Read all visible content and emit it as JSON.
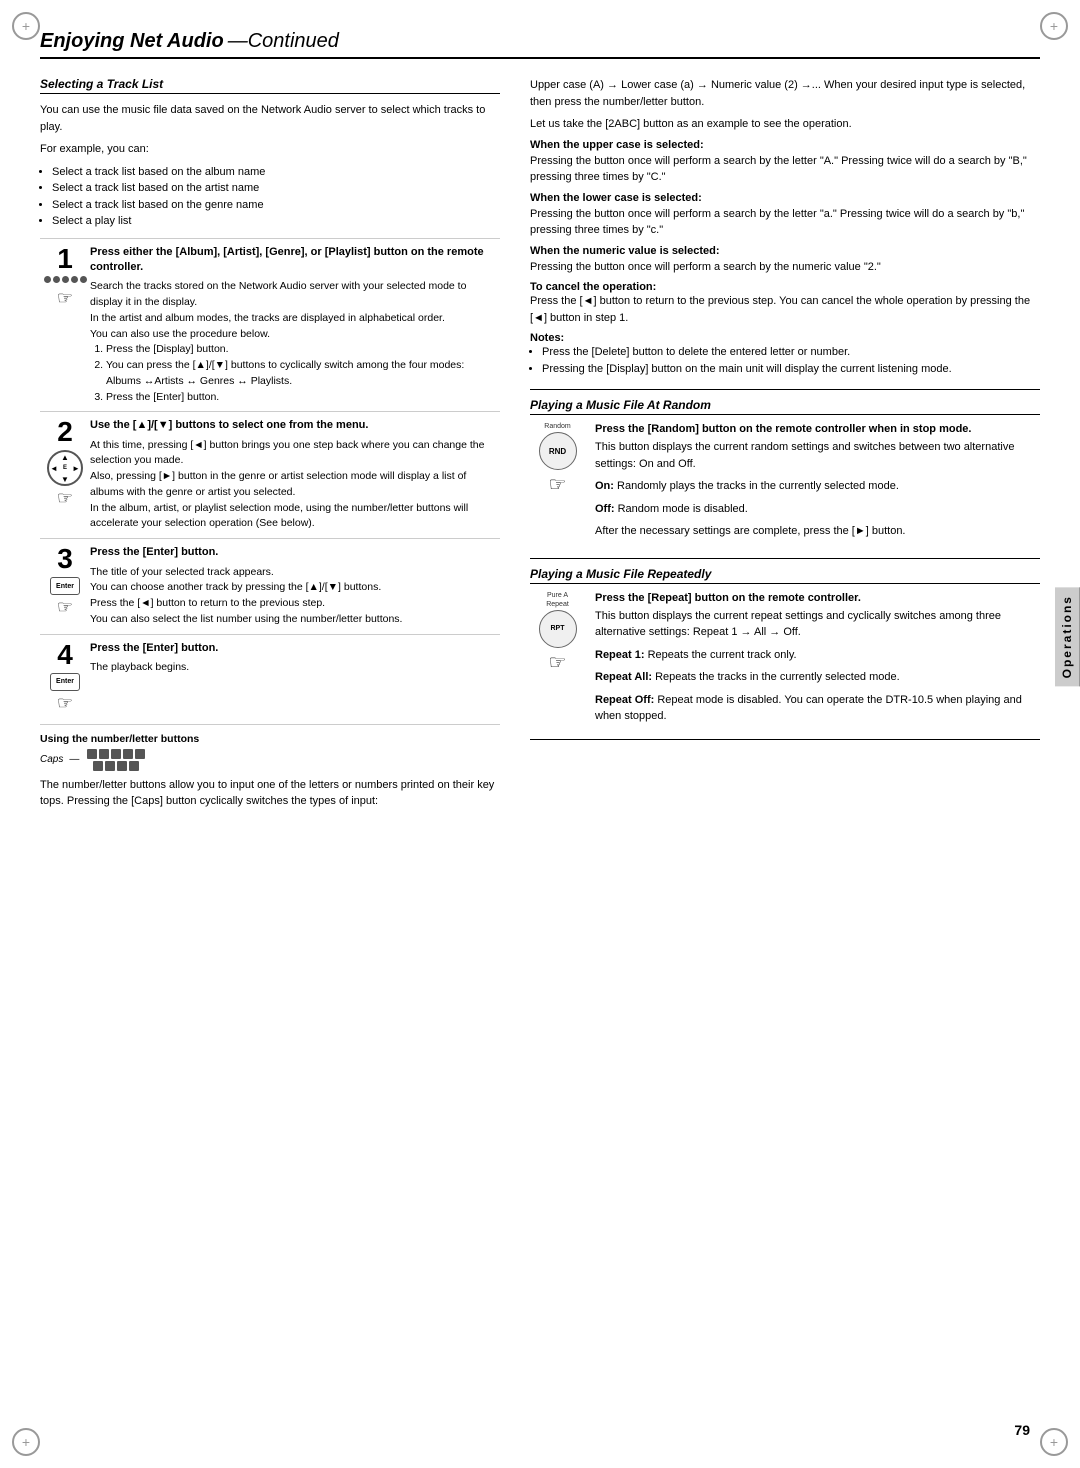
{
  "page": {
    "number": "79",
    "title_main": "Enjoying Net Audio",
    "title_continued": "—Continued"
  },
  "sidebar": {
    "label": "Operations"
  },
  "left_col": {
    "section_heading": "Selecting a Track List",
    "intro_text": "You can use the music file data saved on the Network Audio server to select which tracks to play.",
    "example_label": "For example, you can:",
    "bullets": [
      "Select a track list based on the album name",
      "Select a track list based on the artist name",
      "Select a track list based on the genre name",
      "Select a play list"
    ],
    "steps": [
      {
        "number": "1",
        "heading": "Press either the [Album], [Artist], [Genre], or [Playlist] button on the remote controller.",
        "body": "Search the tracks stored on the Network Audio server with your selected mode to display it in the display.\nIn the artist and album modes, the tracks are displayed in alphabetical order.\nYou can also use the procedure below.\n1. Press the [Display] button.\n2. You can press the [▲]/[▼] buttons to cyclically switch among the four modes: Albums ↔Artists ↔ Genres ↔ Playlists.\n3. Press the [Enter] button."
      },
      {
        "number": "2",
        "heading": "Use the [▲]/[▼] buttons to select one from the menu.",
        "body": "At this time, pressing [◄] button brings you one step back where you can change the selection you made.\nAlso, pressing [►] button in the genre or artist selection mode will display a list of albums with the genre or artist you selected.\nIn the album, artist, or playlist selection mode, using the number/letter buttons will accelerate your selection operation (See below)."
      },
      {
        "number": "3",
        "heading": "Press the [Enter] button.",
        "body": "The title of your selected track appears.\nYou can choose another track by pressing the [▲]/[▼] buttons.\nPress the [◄] button to return to the previous step.\nYou can also select the list number using the number/letter buttons."
      },
      {
        "number": "4",
        "heading": "Press the [Enter] button.",
        "body": "The playback begins."
      }
    ],
    "caps_section": {
      "heading": "Using the number/letter buttons",
      "caps_label": "Caps",
      "body": "The number/letter buttons allow you to input one of the letters or numbers printed on their key tops. Pressing the [Caps] button cyclically switches the types of input:"
    }
  },
  "right_col": {
    "input_type_text": "Upper case (A) → Lower case (a) → Numeric value (2) →... When your desired input type is selected, then press the number/letter button.",
    "example_text": "Let us take the [2ABC] button as an example to see the operation.",
    "when_upper": {
      "heading": "When the upper case is selected:",
      "body": "Pressing the button once will perform a search by the letter \"A.\" Pressing twice will do a search by \"B,\" pressing three times by \"C.\""
    },
    "when_lower": {
      "heading": "When the lower case is selected:",
      "body": "Pressing the button once will perform a search by the letter \"a.\" Pressing twice will do a search by \"b,\" pressing three times by \"c.\""
    },
    "when_numeric": {
      "heading": "When the numeric value is selected:",
      "body": "Pressing the button once will perform a search by the numeric value \"2.\""
    },
    "cancel": {
      "heading": "To cancel the operation:",
      "body": "Press the [◄] button to return to the previous step. You can cancel the whole operation by pressing the [◄] button in step 1."
    },
    "notes": {
      "label": "Notes:",
      "items": [
        "Press the [Delete] button to delete the entered letter or number.",
        "Pressing the [Display] button on the main unit will display the current listening mode."
      ]
    },
    "random_section": {
      "heading": "Playing a Music File At Random",
      "step_heading": "Press the [Random] button on the remote controller when in stop mode.",
      "body": "This button displays the current random settings and switches between two alternative settings: On and Off.\nOn: Randomly plays the tracks in the currently selected mode.\nOff: Random mode is disabled.\nAfter the necessary settings are complete, press the [►] button.",
      "on_label": "On:",
      "on_text": "Randomly plays the tracks in the currently selected mode.",
      "off_label": "Off:",
      "off_text": "Random mode is disabled.",
      "after_text": "After the necessary settings are complete, press the [►] button."
    },
    "repeat_section": {
      "heading": "Playing a Music File Repeatedly",
      "step_heading": "Press the [Repeat] button on the remote controller.",
      "body": "This button displays the current repeat settings and cyclically switches among three alternative settings: Repeat 1 → All → Off.",
      "repeat1_label": "Repeat 1:",
      "repeat1_text": "Repeats the current track only.",
      "repeatall_label": "Repeat All:",
      "repeatall_text": "Repeats the tracks in the currently selected mode.",
      "repeatoff_label": "Repeat Off:",
      "repeatoff_text": "Repeat mode is disabled.\nYou can operate the DTR-10.5 when playing and when stopped."
    }
  }
}
